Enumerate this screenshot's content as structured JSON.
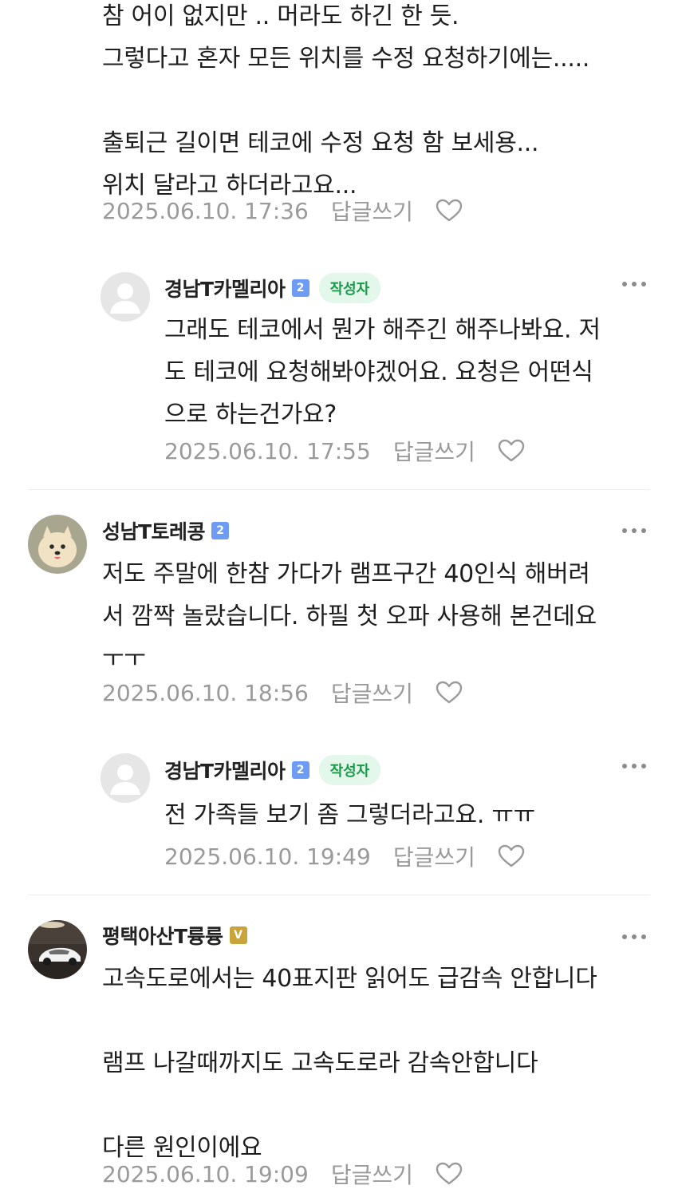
{
  "comments": [
    {
      "body": "참 어이 없지만 .. 머라도 하긴 한 듯.\n그렇다고 혼자 모든 위치를 수정 요청하기에는.....\n\n출퇴근 길이면 테코에 수정 요청 함 보세용...\n위치 달라고 하더라고요...",
      "date": "2025.06.10. 17:36",
      "reply_label": "답글쓰기"
    },
    {
      "nickname": "경남T카멜리아",
      "level": "2",
      "author_badge": "작성자",
      "body": "그래도 테코에서 뭔가 해주긴 해주나봐요. 저\n도 테코에 요청해봐야겠어요. 요청은 어떤식\n으로 하는건가요?",
      "date": "2025.06.10. 17:55",
      "reply_label": "답글쓰기"
    },
    {
      "nickname": "성남T토레콩",
      "level": "2",
      "body": "저도 주말에 한참 가다가 램프구간 40인식 해버려\n서 깜짝 놀랐습니다. 하필 첫 오파 사용해 본건데요\nㅜㅜ",
      "date": "2025.06.10. 18:56",
      "reply_label": "답글쓰기"
    },
    {
      "nickname": "경남T카멜리아",
      "level": "2",
      "author_badge": "작성자",
      "body": "전 가족들 보기 좀 그렇더라고요. ㅠㅠ",
      "date": "2025.06.10. 19:49",
      "reply_label": "답글쓰기"
    },
    {
      "nickname": "평택아산T륭륭",
      "level": "V",
      "body": "고속도로에서는 40표지판 읽어도 급감속 안합니다\n\n램프 나갈때까지도 고속도로라 감속안합니다\n\n다른 원인이에요",
      "date": "2025.06.10. 19:09",
      "reply_label": "답글쓰기"
    }
  ],
  "colors": {
    "author_badge_bg": "#e3f7ea",
    "author_badge_text": "#1a9b4b",
    "level_blue": "#6e9bf3",
    "level_gold": "#c8a43a",
    "meta_text": "#9a9a9a"
  },
  "icons": {
    "heart": "heart-outline-icon",
    "more": "more-dots-icon",
    "default_avatar": "default-profile-icon"
  }
}
